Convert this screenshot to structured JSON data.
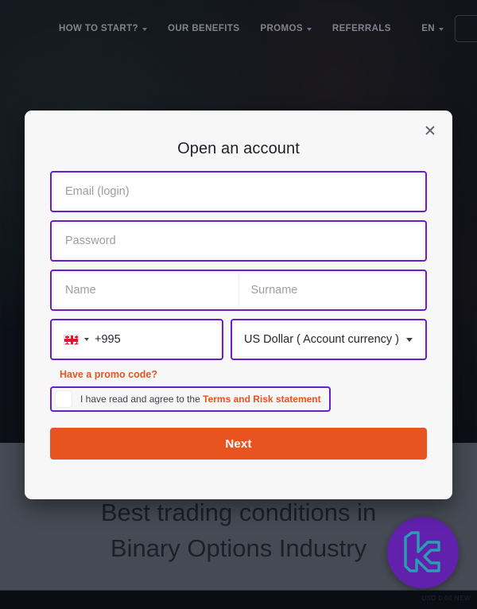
{
  "nav": {
    "items": [
      {
        "label": "HOW TO START?",
        "has_caret": true,
        "icon": "chevron-down-icon"
      },
      {
        "label": "OUR BENEFITS",
        "has_caret": false,
        "icon": ""
      },
      {
        "label": "PROMOS",
        "has_caret": true,
        "icon": "chevron-down-icon"
      },
      {
        "label": "REFERRALS",
        "has_caret": false,
        "icon": ""
      }
    ],
    "language": "EN",
    "language_icon": "chevron-down-icon"
  },
  "hero": {
    "line1": "Best trading conditions in",
    "line2": "Binary Options Industry"
  },
  "badge": {
    "icon": "brand-logo-icon",
    "circle_color": "#8b2bf5",
    "mark_color": "#3ce0ff"
  },
  "footer": {
    "note": "USD 0.00  NEW"
  },
  "modal": {
    "title": "Open an account",
    "close_icon": "close-icon",
    "accent_border": "#6a1ec7",
    "accent_orange": "#e8541f",
    "fields": {
      "email_placeholder": "Email (login)",
      "password_placeholder": "Password",
      "name_placeholder": "Name",
      "surname_placeholder": "Surname",
      "phone_code": "+995",
      "phone_flag_icon": "georgia-flag-icon",
      "phone_caret_icon": "chevron-down-icon",
      "currency_value": "US Dollar ( Account currency )",
      "currency_caret_icon": "chevron-down-icon"
    },
    "promo_link": "Have a promo code?",
    "agreement": {
      "text_before": "I have read and agree to the ",
      "link": "Terms and Risk statement",
      "checked": false
    },
    "submit_label": "Next"
  }
}
